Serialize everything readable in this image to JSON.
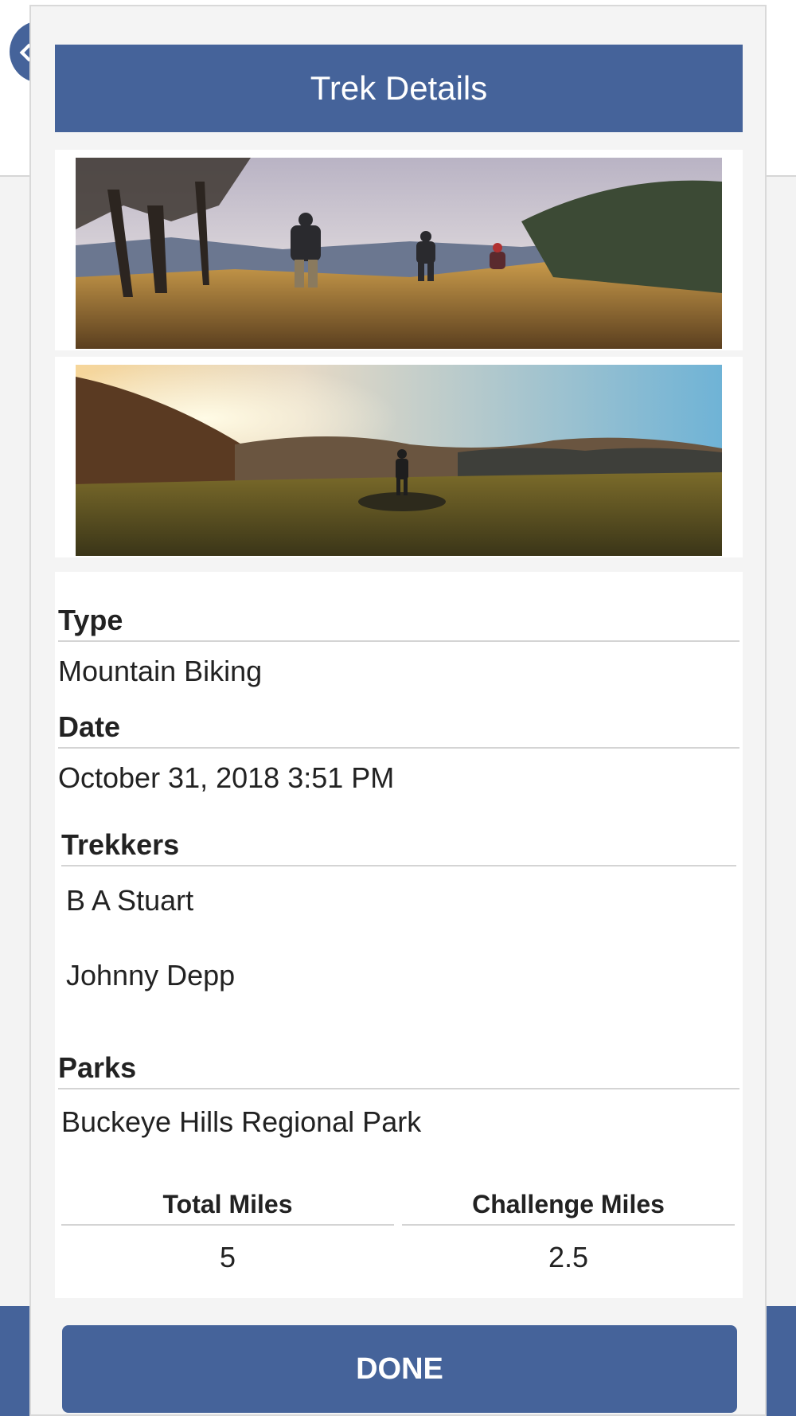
{
  "modal": {
    "title": "Trek Details",
    "done_label": "DONE"
  },
  "photos": [
    {
      "icon": "hikers-photo"
    },
    {
      "icon": "sunset-hiker-photo"
    }
  ],
  "details": {
    "type_label": "Type",
    "type_value": "Mountain Biking",
    "date_label": "Date",
    "date_value": "October 31, 2018 3:51 PM",
    "trekkers_label": "Trekkers",
    "trekkers": [
      "B A Stuart",
      "Johnny Depp"
    ],
    "parks_label": "Parks",
    "parks": [
      "Buckeye Hills Regional Park"
    ],
    "total_miles_label": "Total Miles",
    "total_miles_value": "5",
    "challenge_miles_label": "Challenge Miles",
    "challenge_miles_value": "2.5"
  },
  "colors": {
    "accent": "#45639a",
    "background": "#f4f4f4"
  }
}
